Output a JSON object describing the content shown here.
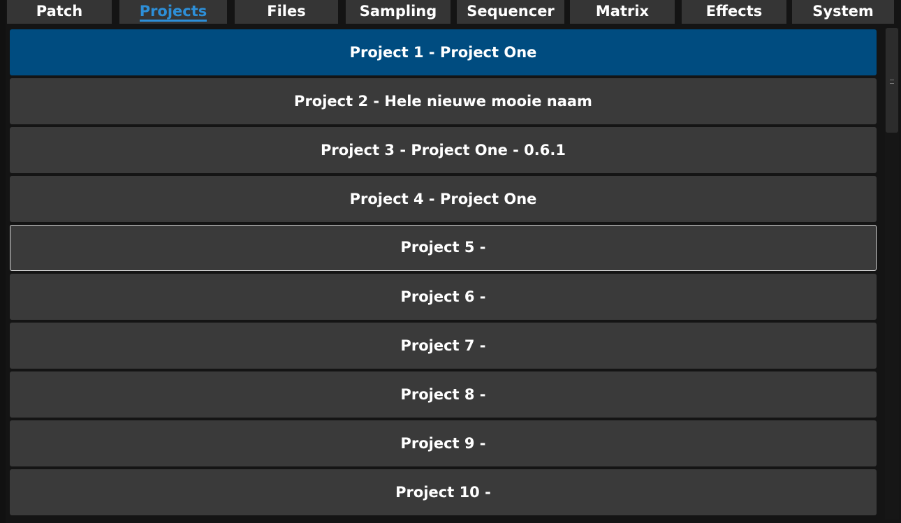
{
  "tabs": [
    {
      "label": "Patch",
      "active": false
    },
    {
      "label": "Projects",
      "active": true
    },
    {
      "label": "Files",
      "active": false
    },
    {
      "label": "Sampling",
      "active": false
    },
    {
      "label": "Sequencer",
      "active": false
    },
    {
      "label": "Matrix",
      "active": false
    },
    {
      "label": "Effects",
      "active": false
    },
    {
      "label": "System",
      "active": false
    }
  ],
  "projects": [
    {
      "label": "Project 1 - Project One",
      "state": "selected"
    },
    {
      "label": "Project 2 - Hele nieuwe mooie naam",
      "state": "normal"
    },
    {
      "label": "Project 3 - Project One - 0.6.1",
      "state": "normal"
    },
    {
      "label": "Project 4 - Project One",
      "state": "normal"
    },
    {
      "label": "Project 5 -",
      "state": "focused"
    },
    {
      "label": "Project 6 -",
      "state": "normal"
    },
    {
      "label": "Project 7 -",
      "state": "normal"
    },
    {
      "label": "Project 8 -",
      "state": "normal"
    },
    {
      "label": "Project 9 -",
      "state": "normal"
    },
    {
      "label": "Project 10 -",
      "state": "normal"
    }
  ],
  "colors": {
    "background": "#141414",
    "tab_bg": "#353535",
    "active_tab_text": "#2d8fd8",
    "row_bg": "#3a3a3a",
    "selected_row_bg": "#004c80",
    "focus_border": "#d8d8d8",
    "text": "#ffffff"
  },
  "icons": {
    "scrollbar_grip": "grip-lines-icon"
  }
}
